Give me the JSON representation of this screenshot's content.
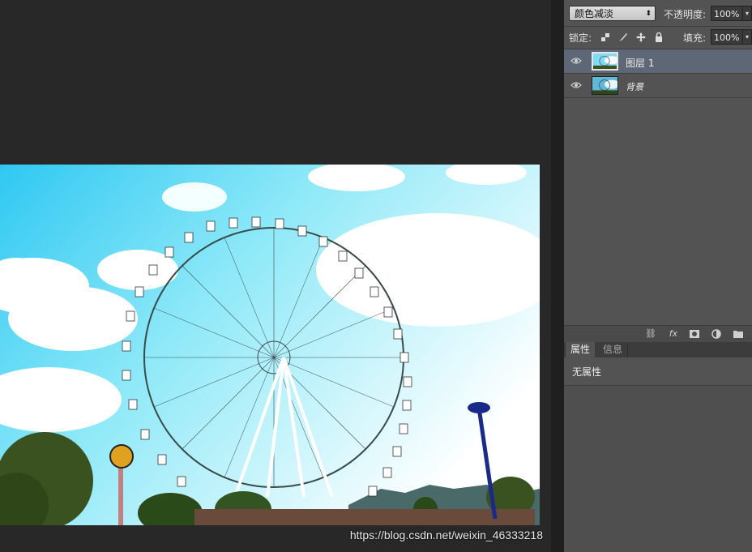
{
  "layers_panel": {
    "blend_mode": "颜色减淡",
    "opacity_label": "不透明度:",
    "opacity_value": "100%",
    "lock_label": "锁定:",
    "fill_label": "填充:",
    "fill_value": "100%",
    "layers": [
      {
        "name": "图层 1",
        "selected": true
      },
      {
        "name": "背景",
        "selected": false
      }
    ]
  },
  "properties_panel": {
    "tabs": [
      "属性",
      "信息"
    ],
    "content": "无属性"
  },
  "watermark": "https://blog.csdn.net/weixin_46333218",
  "colors": {
    "workspace": "#282828",
    "panel": "#535353",
    "selected_layer": "#5e6775",
    "sky": "#5fe0f4"
  },
  "icons": [
    "eye-icon",
    "lock-transparent-icon",
    "lock-brush-icon",
    "lock-move-icon",
    "lock-all-icon",
    "link-icon",
    "fx-icon",
    "mask-icon",
    "adjustment-icon",
    "folder-icon"
  ]
}
